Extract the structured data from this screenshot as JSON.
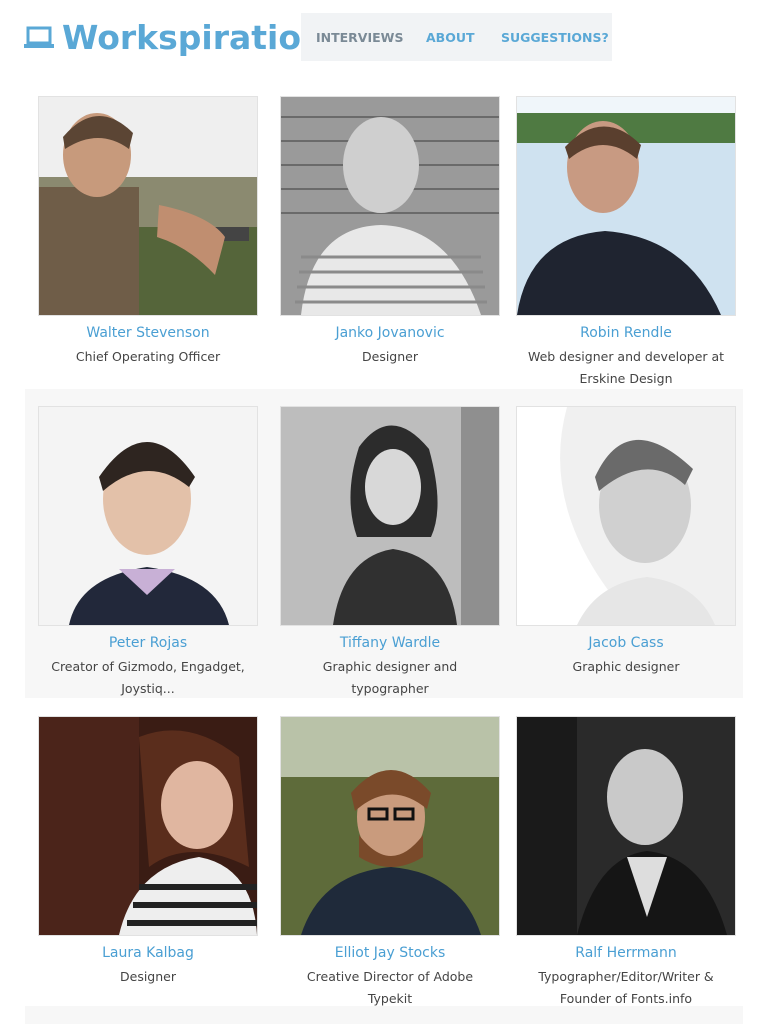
{
  "header": {
    "brand": "Workspiration",
    "nav": [
      "INTERVIEWS",
      "ABOUT",
      "SUGGESTIONS?"
    ]
  },
  "colors": {
    "accent": "#5aa8d6",
    "nav_bg": "#f1f3f5",
    "row_band": "#f7f7f7"
  },
  "people": [
    {
      "name": "Walter Stevenson",
      "title": "Chief Operating Officer"
    },
    {
      "name": "Janko Jovanovic",
      "title": "Designer"
    },
    {
      "name": "Robin Rendle",
      "title": "Web designer and developer at Erskine Design"
    },
    {
      "name": "Peter Rojas",
      "title": "Creator of Gizmodo, Engadget, Joystiq..."
    },
    {
      "name": "Tiffany Wardle",
      "title": "Graphic designer and typographer"
    },
    {
      "name": "Jacob Cass",
      "title": "Graphic designer"
    },
    {
      "name": "Laura Kalbag",
      "title": "Designer"
    },
    {
      "name": "Elliot Jay Stocks",
      "title": "Creative Director of Adobe Typekit"
    },
    {
      "name": "Ralf Herrmann",
      "title": "Typographer/Editor/Writer & Founder of Fonts.info"
    }
  ]
}
